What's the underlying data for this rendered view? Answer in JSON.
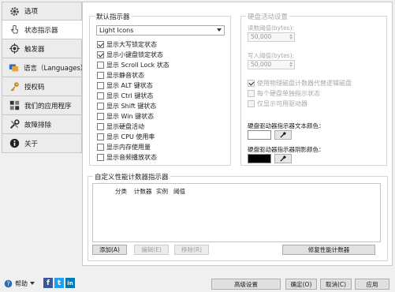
{
  "sidebar": {
    "items": [
      {
        "label": "选项",
        "icon": "gear-icon"
      },
      {
        "label": "状态指示器",
        "icon": "pointer-icon"
      },
      {
        "label": "触发器",
        "icon": "target-icon"
      },
      {
        "label": "语言（Languages）",
        "icon": "globe-icon"
      },
      {
        "label": "授权码",
        "icon": "key-icon"
      },
      {
        "label": "我们的应用程序",
        "icon": "puzzle-icon"
      },
      {
        "label": "故障排除",
        "icon": "tools-icon"
      },
      {
        "label": "关于",
        "icon": "info-icon"
      }
    ]
  },
  "main": {
    "default_group": {
      "legend": "默认指示器",
      "theme_select": "Light Icons",
      "checkboxes": [
        {
          "label": "显示大写锁定状态",
          "checked": true
        },
        {
          "label": "显示小键盘锁定状态",
          "checked": true
        },
        {
          "label": "显示 Scroll Lock 状态",
          "checked": false
        },
        {
          "label": "显示静音状态",
          "checked": false
        },
        {
          "label": "显示 ALT 键状态",
          "checked": false
        },
        {
          "label": "显示 Ctrl 键状态",
          "checked": false
        },
        {
          "label": "显示 Shift 键状态",
          "checked": false
        },
        {
          "label": "显示 Win 键状态",
          "checked": false
        },
        {
          "label": "显示硬盘活动",
          "checked": false
        },
        {
          "label": "显示 CPU 使用率",
          "checked": false
        },
        {
          "label": "显示内存使用量",
          "checked": false
        },
        {
          "label": "显示音频播放状态",
          "checked": false
        }
      ]
    },
    "disk_group": {
      "legend": "硬盘活动设置",
      "read_label": "读数阈值(bytes):",
      "read_value": "50,000",
      "write_label": "写入阈值(bytes):",
      "write_value": "50,000",
      "options": [
        {
          "label": "使用物理磁盘计数器代替逻辑磁盘",
          "checked": true
        },
        {
          "label": "每个硬盘单独指示状态",
          "checked": false
        },
        {
          "label": "仅显示可用驱动器",
          "checked": false
        }
      ],
      "text_color_label": "硬盘驱动器指示器文本颜色：",
      "text_color": "#ffffff",
      "shadow_color_label": "硬盘驱动器指示器阴影颜色：",
      "shadow_color": "#000000"
    },
    "custom_group": {
      "legend": "自定义性能计数器指示器",
      "columns": [
        "分类",
        "计数器",
        "实例",
        "阈值"
      ],
      "add_button": "添加(A)",
      "edit_button": "编辑(E)",
      "remove_button": "移除(R)",
      "repair_button": "修复性能计数器"
    }
  },
  "footer": {
    "help_label": "帮助",
    "advanced_button": "高级设置",
    "ok_button": "确定(O)",
    "cancel_button": "取消(C)",
    "apply_button": "应用",
    "social": {
      "facebook": "f",
      "twitter": "t",
      "linkedin": "in"
    }
  }
}
